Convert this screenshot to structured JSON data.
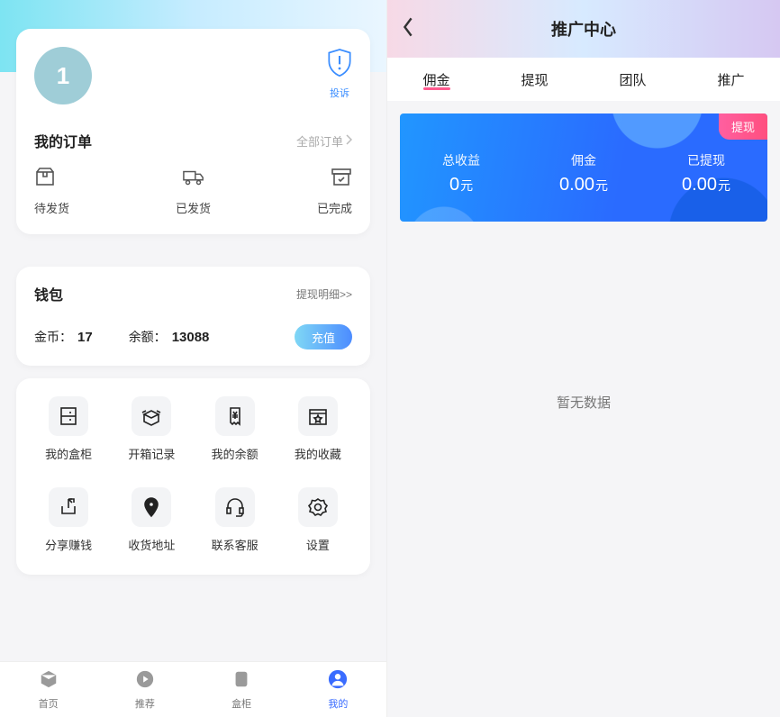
{
  "left": {
    "avatar_label": "1",
    "complaint": {
      "label": "投诉"
    },
    "orders": {
      "title": "我的订单",
      "all_label": "全部订单",
      "items": [
        {
          "label": "待发货"
        },
        {
          "label": "已发货"
        },
        {
          "label": "已完成"
        }
      ]
    },
    "wallet": {
      "title": "钱包",
      "detail_label": "提现明细>>",
      "coin_label": "金币：",
      "coin_value": "17",
      "balance_label": "余额：",
      "balance_value": "13088",
      "recharge_label": "充值"
    },
    "grid": [
      {
        "label": "我的盒柜"
      },
      {
        "label": "开箱记录"
      },
      {
        "label": "我的余额"
      },
      {
        "label": "我的收藏"
      },
      {
        "label": "分享赚钱"
      },
      {
        "label": "收货地址"
      },
      {
        "label": "联系客服"
      },
      {
        "label": "设置"
      }
    ],
    "tabbar": [
      {
        "label": "首页"
      },
      {
        "label": "推荐"
      },
      {
        "label": "盒柜"
      },
      {
        "label": "我的"
      }
    ],
    "tabbar_active": 3
  },
  "right": {
    "title": "推广中心",
    "tabs": [
      {
        "label": "佣金"
      },
      {
        "label": "提现"
      },
      {
        "label": "团队"
      },
      {
        "label": "推广"
      }
    ],
    "tabs_active": 0,
    "withdraw_label": "提现",
    "stats": [
      {
        "label": "总收益",
        "value": "0",
        "unit": "元"
      },
      {
        "label": "佣金",
        "value": "0.00",
        "unit": "元"
      },
      {
        "label": "已提现",
        "value": "0.00",
        "unit": "元"
      }
    ],
    "empty_label": "暂无数据"
  }
}
